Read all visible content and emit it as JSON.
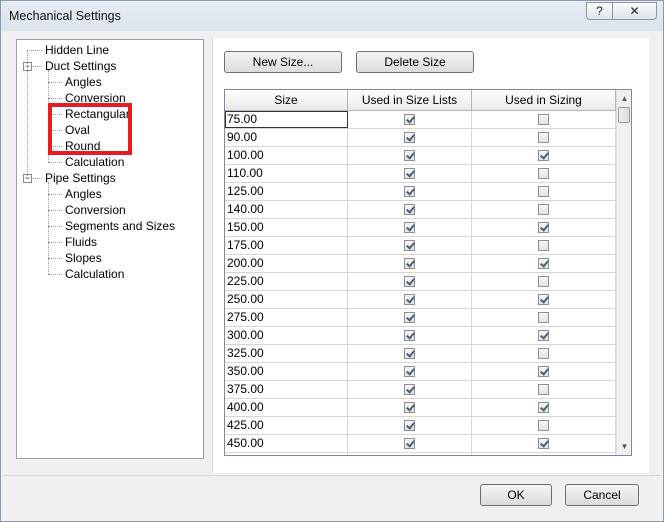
{
  "window": {
    "title": "Mechanical Settings",
    "help_label": "?",
    "close_label": "✕"
  },
  "tree": {
    "items": [
      {
        "label": "Hidden Line",
        "level": 0,
        "expander": ""
      },
      {
        "label": "Duct Settings",
        "level": 0,
        "expander": "−"
      },
      {
        "label": "Angles",
        "level": 1,
        "expander": ""
      },
      {
        "label": "Conversion",
        "level": 1,
        "expander": ""
      },
      {
        "label": "Rectangular",
        "level": 1,
        "expander": ""
      },
      {
        "label": "Oval",
        "level": 1,
        "expander": ""
      },
      {
        "label": "Round",
        "level": 1,
        "expander": ""
      },
      {
        "label": "Calculation",
        "level": 1,
        "expander": ""
      },
      {
        "label": "Pipe Settings",
        "level": 0,
        "expander": "−"
      },
      {
        "label": "Angles",
        "level": 1,
        "expander": ""
      },
      {
        "label": "Conversion",
        "level": 1,
        "expander": ""
      },
      {
        "label": "Segments and Sizes",
        "level": 1,
        "expander": ""
      },
      {
        "label": "Fluids",
        "level": 1,
        "expander": ""
      },
      {
        "label": "Slopes",
        "level": 1,
        "expander": ""
      },
      {
        "label": "Calculation",
        "level": 1,
        "expander": ""
      }
    ]
  },
  "toolbar": {
    "new_size_label": "New Size...",
    "delete_size_label": "Delete Size"
  },
  "grid": {
    "columns": [
      "Size",
      "Used in Size Lists",
      "Used in Sizing"
    ],
    "rows": [
      {
        "size": "75.00",
        "lists": true,
        "sizing": false
      },
      {
        "size": "90.00",
        "lists": true,
        "sizing": false
      },
      {
        "size": "100.00",
        "lists": true,
        "sizing": true
      },
      {
        "size": "110.00",
        "lists": true,
        "sizing": false
      },
      {
        "size": "125.00",
        "lists": true,
        "sizing": false
      },
      {
        "size": "140.00",
        "lists": true,
        "sizing": false
      },
      {
        "size": "150.00",
        "lists": true,
        "sizing": true
      },
      {
        "size": "175.00",
        "lists": true,
        "sizing": false
      },
      {
        "size": "200.00",
        "lists": true,
        "sizing": true
      },
      {
        "size": "225.00",
        "lists": true,
        "sizing": false
      },
      {
        "size": "250.00",
        "lists": true,
        "sizing": true
      },
      {
        "size": "275.00",
        "lists": true,
        "sizing": false
      },
      {
        "size": "300.00",
        "lists": true,
        "sizing": true
      },
      {
        "size": "325.00",
        "lists": true,
        "sizing": false
      },
      {
        "size": "350.00",
        "lists": true,
        "sizing": true
      },
      {
        "size": "375.00",
        "lists": true,
        "sizing": false
      },
      {
        "size": "400.00",
        "lists": true,
        "sizing": true
      },
      {
        "size": "425.00",
        "lists": true,
        "sizing": false
      },
      {
        "size": "450.00",
        "lists": true,
        "sizing": true
      },
      {
        "size": "",
        "lists": true,
        "sizing": false
      }
    ],
    "selected_row": 0
  },
  "footer": {
    "ok_label": "OK",
    "cancel_label": "Cancel"
  }
}
